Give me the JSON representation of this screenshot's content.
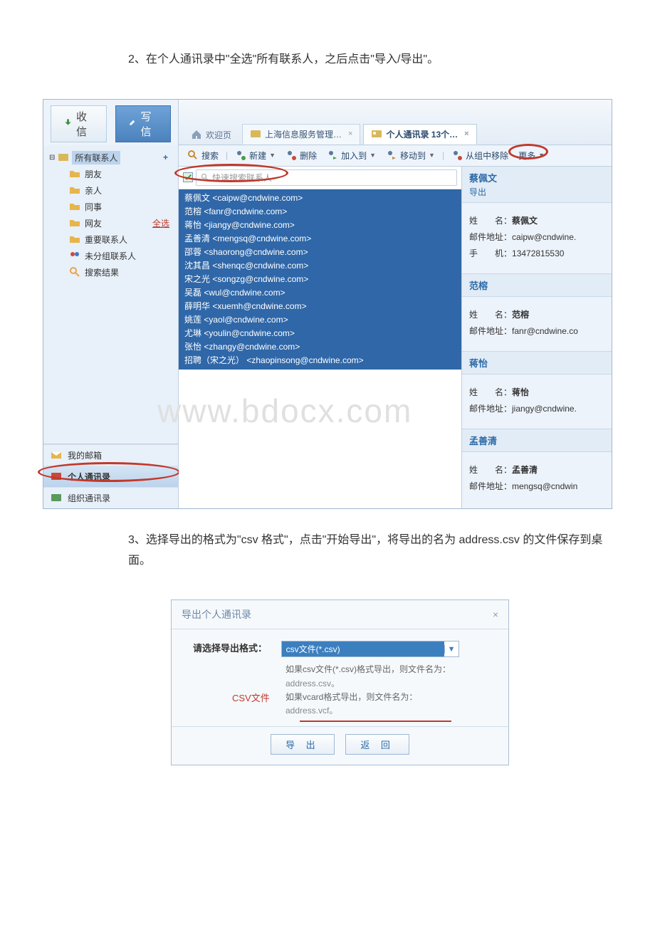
{
  "instructions": {
    "step2": "2、在个人通讯录中\"全选\"所有联系人，之后点击\"导入/导出\"。",
    "step3": "3、选择导出的格式为\"csv 格式\"，点击\"开始导出\"，将导出的名为 address.csv 的文件保存到桌面。"
  },
  "watermark": "www.bdocx.com",
  "topButtons": {
    "receive": "收 信",
    "write": "写 信"
  },
  "sidebar": {
    "root": "所有联系人",
    "plus": "+",
    "items": [
      "朋友",
      "亲人",
      "同事",
      "网友",
      "重要联系人",
      "未分组联系人",
      "搜索结果"
    ],
    "selectAll": "全选",
    "bottomNav": {
      "mailbox": "我的邮箱",
      "personal": "个人通讯录",
      "org": "组织通讯录"
    }
  },
  "tabs": {
    "welcome": "欢迎页",
    "mid": "上海信息服务管理…",
    "active": "个人通讯录 13个…"
  },
  "toolbar": {
    "search": "搜索",
    "new": "新建",
    "delete": "删除",
    "addTo": "加入到",
    "moveTo": "移动到",
    "removeFromGroup": "从组中移除",
    "more": "更多"
  },
  "searchPlaceholder": "快速搜索联系人",
  "contacts": [
    "蔡佩文 <caipw@cndwine.com>",
    "范榕 <fanr@cndwine.com>",
    "蒋怡 <jiangy@cndwine.com>",
    "孟善清 <mengsq@cndwine.com>",
    "邵蓉 <shaorong@cndwine.com>",
    "沈其昌 <shenqc@cndwine.com>",
    "宋之光 <songzg@cndwine.com>",
    "吴磊 <wul@cndwine.com>",
    "薛明华 <xuemh@cndwine.com>",
    "姚莲 <yaol@cndwine.com>",
    "尤琳 <youlin@cndwine.com>",
    "张怡 <zhangy@cndwine.com>",
    "招聘（宋之光） <zhaopinsong@cndwine.com>"
  ],
  "detailPane": {
    "header": {
      "name": "蔡佩文",
      "sub": "导出"
    },
    "labels": {
      "name": "姓　　名：",
      "email": "邮件地址：",
      "phone": "手　　机："
    },
    "cards": [
      {
        "section": "蔡佩文",
        "name": "蔡佩文",
        "email": "caipw@cndwine.",
        "phone": "13472815530"
      },
      {
        "section": "范榕",
        "name": "范榕",
        "email": "fanr@cndwine.co"
      },
      {
        "section": "蒋怡",
        "name": "蒋怡",
        "email": "jiangy@cndwine."
      },
      {
        "section": "孟善清",
        "name": "孟善清",
        "email": "mengsq@cndwin"
      }
    ]
  },
  "exportDialog": {
    "title": "导出个人通讯录",
    "label": "请选择导出格式：",
    "selected": "csv文件(*.csv)",
    "hint1": "如果csv文件(*.csv)格式导出，则文件名为：",
    "file1": "address.csv。",
    "hint2": "如果vcard格式导出，则文件名为：",
    "file2": "address.vcf。",
    "csvAnno": "CSV文件",
    "export": "导 出",
    "back": "返 回"
  }
}
